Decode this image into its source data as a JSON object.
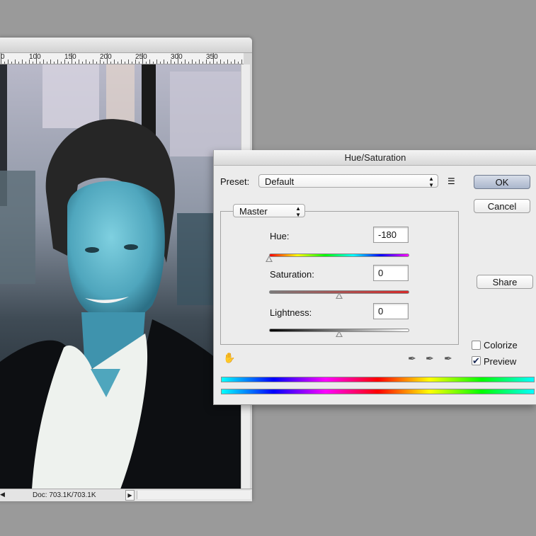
{
  "document": {
    "ruler_labels": [
      "0",
      "100",
      "150",
      "200",
      "250",
      "300",
      "350"
    ],
    "doc_size": "Doc: 703.1K/703.1K"
  },
  "dialog": {
    "title": "Hue/Saturation",
    "preset_label": "Preset:",
    "preset_value": "Default",
    "channel_value": "Master",
    "hue_label": "Hue:",
    "hue_value": "-180",
    "hue_fraction": 0.0,
    "saturation_label": "Saturation:",
    "saturation_value": "0",
    "saturation_fraction": 0.5,
    "lightness_label": "Lightness:",
    "lightness_value": "0",
    "lightness_fraction": 0.5,
    "ok_label": "OK",
    "cancel_label": "Cancel",
    "share_label": "Share",
    "colorize_label": "Colorize",
    "colorize_checked": false,
    "preview_label": "Preview",
    "preview_checked": true
  },
  "colors": {
    "workspace": "#9a9a9a",
    "ok_button": "#aab6cc",
    "skin_tone": "#5fb3c8"
  }
}
